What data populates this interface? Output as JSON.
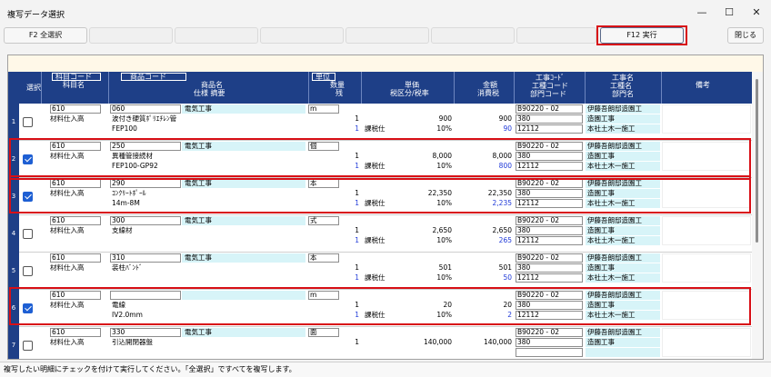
{
  "window": {
    "title": "複写データ選択",
    "minimize": "—",
    "maximize": "☐",
    "close": "✕"
  },
  "toolbar": {
    "select_all": "F2 全選択",
    "execute": "F12 実行",
    "close": "閉じる"
  },
  "columns": {
    "select": "選択",
    "account_code": "科目コード",
    "account_name": "科目名",
    "product_code": "商品コード",
    "product_name": "商品名",
    "spec": "仕様 摘要",
    "unit": "単位",
    "qty": "数量",
    "remaining": "残",
    "unit_price": "単価",
    "tax_cat_rate": "税区分/税率",
    "amount": "金額",
    "consumption_tax": "消費税",
    "construction_code": "工事ｺｰﾄﾞ",
    "work_type_code": "工種コード",
    "department_code": "部門コード",
    "construction_name": "工事名",
    "work_type_name": "工種名",
    "department_name": "部門名",
    "remarks": "備考"
  },
  "rows": [
    {
      "no": "1",
      "checked": false,
      "account_code": "610",
      "account_name": "材料仕入高",
      "product_code": "060",
      "product_cat": "電気工事",
      "product_name": "波付き硬質ﾎﾟﾘｴﾁﾚﾝ管",
      "spec": "FEP100",
      "unit": "m",
      "qty": "1",
      "remaining": "1",
      "unit_price": "900",
      "tax_cat": "課税仕",
      "tax_rate": "10%",
      "amount": "900",
      "tax": "90",
      "construction_code": "B90220 - 02",
      "work_type_code": "380",
      "department_code": "12112",
      "construction_name": "伊藤吾朗邸造園工",
      "work_type_name": "造園工事",
      "department_name": "本社土木一施工"
    },
    {
      "no": "2",
      "checked": true,
      "account_code": "610",
      "account_name": "材料仕入高",
      "product_code": "250",
      "product_cat": "電気工事",
      "product_name": "異種管接続材",
      "spec": "FEP100-GP92",
      "unit": "個",
      "qty": "1",
      "remaining": "1",
      "unit_price": "8,000",
      "tax_cat": "課税仕",
      "tax_rate": "10%",
      "amount": "8,000",
      "tax": "800",
      "construction_code": "B90220 - 02",
      "work_type_code": "380",
      "department_code": "12112",
      "construction_name": "伊藤吾朗邸造園工",
      "work_type_name": "造園工事",
      "department_name": "本社土木一施工"
    },
    {
      "no": "3",
      "checked": true,
      "account_code": "610",
      "account_name": "材料仕入高",
      "product_code": "290",
      "product_cat": "電気工事",
      "product_name": "ｺﾝｸﾘｰﾄﾎﾟｰﾙ",
      "spec": "14m-8M",
      "unit": "本",
      "qty": "1",
      "remaining": "1",
      "unit_price": "22,350",
      "tax_cat": "課税仕",
      "tax_rate": "10%",
      "amount": "22,350",
      "tax": "2,235",
      "construction_code": "B90220 - 02",
      "work_type_code": "380",
      "department_code": "12112",
      "construction_name": "伊藤吾朗邸造園工",
      "work_type_name": "造園工事",
      "department_name": "本社土木一施工"
    },
    {
      "no": "4",
      "checked": false,
      "account_code": "610",
      "account_name": "材料仕入高",
      "product_code": "300",
      "product_cat": "電気工事",
      "product_name": "支線材",
      "spec": "",
      "unit": "式",
      "qty": "1",
      "remaining": "1",
      "unit_price": "2,650",
      "tax_cat": "課税仕",
      "tax_rate": "10%",
      "amount": "2,650",
      "tax": "265",
      "construction_code": "B90220 - 02",
      "work_type_code": "380",
      "department_code": "12112",
      "construction_name": "伊藤吾朗邸造園工",
      "work_type_name": "造園工事",
      "department_name": "本社土木一施工"
    },
    {
      "no": "5",
      "checked": false,
      "account_code": "610",
      "account_name": "材料仕入高",
      "product_code": "310",
      "product_cat": "電気工事",
      "product_name": "装柱ﾊﾞﾝﾄﾞ",
      "spec": "",
      "unit": "本",
      "qty": "1",
      "remaining": "1",
      "unit_price": "501",
      "tax_cat": "課税仕",
      "tax_rate": "10%",
      "amount": "501",
      "tax": "50",
      "construction_code": "B90220 - 02",
      "work_type_code": "380",
      "department_code": "12112",
      "construction_name": "伊藤吾朗邸造園工",
      "work_type_name": "造園工事",
      "department_name": "本社土木一施工"
    },
    {
      "no": "6",
      "checked": true,
      "account_code": "610",
      "account_name": "材料仕入高",
      "product_code": "",
      "product_cat": "",
      "product_name": "電線",
      "spec": "IV2.0mm",
      "unit": "m",
      "qty": "1",
      "remaining": "1",
      "unit_price": "20",
      "tax_cat": "課税仕",
      "tax_rate": "10%",
      "amount": "20",
      "tax": "2",
      "construction_code": "B90220 - 02",
      "work_type_code": "380",
      "department_code": "12112",
      "construction_name": "伊藤吾朗邸造園工",
      "work_type_name": "造園工事",
      "department_name": "本社土木一施工"
    },
    {
      "no": "7",
      "checked": false,
      "account_code": "610",
      "account_name": "材料仕入高",
      "product_code": "330",
      "product_cat": "電気工事",
      "product_name": "引込開閉器盤",
      "spec": "",
      "unit": "面",
      "qty": "1",
      "remaining": "",
      "unit_price": "140,000",
      "tax_cat": "",
      "tax_rate": "",
      "amount": "140,000",
      "tax": "",
      "construction_code": "B90220 - 02",
      "work_type_code": "380",
      "department_code": "",
      "construction_name": "伊藤吾朗邸造園工",
      "work_type_name": "造園工事",
      "department_name": ""
    }
  ],
  "status": "複写したい明細にチェックを付けて実行してください。「全選択」ですべてを複写します。",
  "colors": {
    "header": "#1e3f87",
    "highlight": "#d80f16",
    "tax_text": "#1f39d8",
    "cell_blue": "#d7f4f8"
  }
}
